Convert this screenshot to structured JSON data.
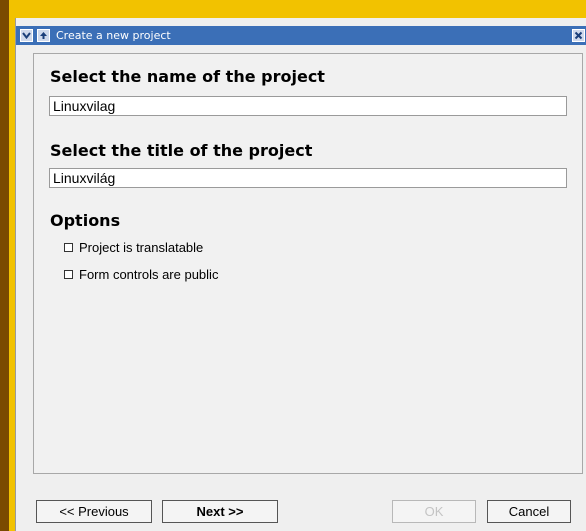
{
  "window": {
    "title": "Create a new project",
    "icons": {
      "menu": "chevron-down-icon",
      "up": "arrow-up-icon",
      "close": "close-icon"
    }
  },
  "form": {
    "name_heading": "Select the name of the project",
    "name_value": "Linuxvilag",
    "title_heading": "Select the title of the project",
    "title_value": "Linuxvilág",
    "options_heading": "Options",
    "options": [
      {
        "label": "Project is translatable",
        "checked": false
      },
      {
        "label": "Form controls are public",
        "checked": false
      }
    ]
  },
  "buttons": {
    "previous": "<< Previous",
    "next": "Next >>",
    "ok": "OK",
    "cancel": "Cancel"
  },
  "colors": {
    "titlebar": "#3b6fb7",
    "desktop": "#f2c200",
    "dialog": "#efefef"
  }
}
